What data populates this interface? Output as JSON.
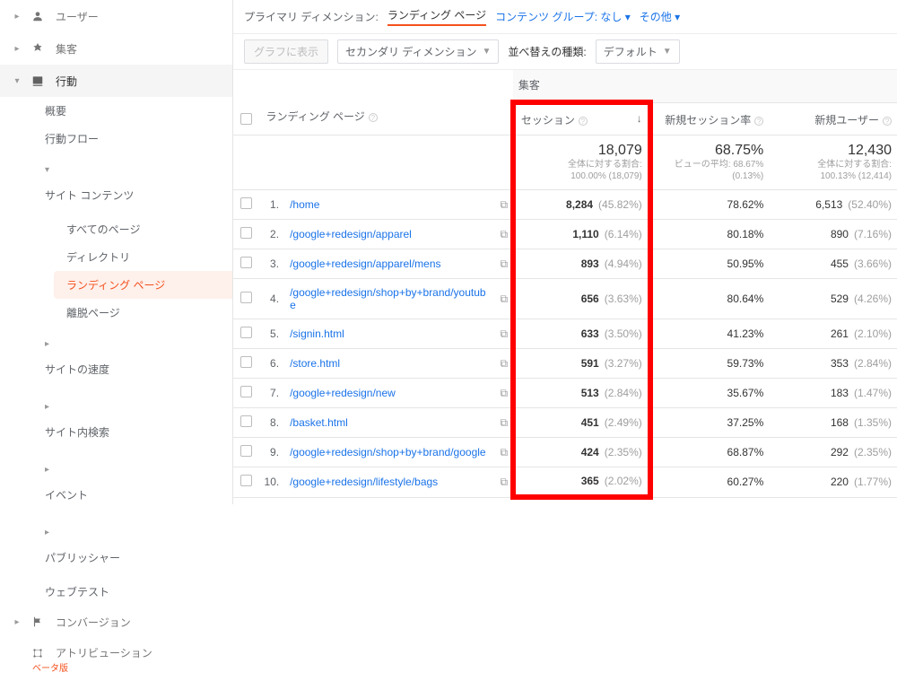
{
  "sidebar": {
    "users": "ユーザー",
    "acquisition": "集客",
    "behavior": "行動",
    "overview": "概要",
    "behavior_flow": "行動フロー",
    "site_content": "サイト コンテンツ",
    "all_pages": "すべてのページ",
    "directory": "ディレクトリ",
    "landing_pages": "ランディング ページ",
    "exit_pages": "離脱ページ",
    "site_speed": "サイトの速度",
    "site_search": "サイト内検索",
    "events": "イベント",
    "publisher": "パブリッシャー",
    "web_test": "ウェブテスト",
    "conversions": "コンバージョン",
    "attribution": "アトリビューション",
    "beta": "ベータ版"
  },
  "dimbar": {
    "primary_label": "プライマリ ディメンション:",
    "landing_page": "ランディング ページ",
    "content_group": "コンテンツ グループ: なし",
    "other": "その他"
  },
  "toolbar": {
    "graph": "グラフに表示",
    "secondary": "セカンダリ ディメンション",
    "sort_label": "並べ替えの種類:",
    "default": "デフォルト"
  },
  "header": {
    "landing_page": "ランディング ページ",
    "group": "集客",
    "sessions": "セッション",
    "new_session_rate": "新規セッション率",
    "new_users": "新規ユーザー"
  },
  "summary": {
    "sessions": {
      "big": "18,079",
      "sub1": "全体に対する割合:",
      "sub2": "100.00% (18,079)"
    },
    "rate": {
      "big": "68.75%",
      "sub1": "ビューの平均: 68.67%",
      "sub2": "(0.13%)"
    },
    "users": {
      "big": "12,430",
      "sub1": "全体に対する割合:",
      "sub2": "100.13% (12,414)"
    }
  },
  "rows": [
    {
      "url": "/home",
      "sess": "8,284",
      "sess_pct": "(45.82%)",
      "rate": "78.62%",
      "users": "6,513",
      "users_pct": "(52.40%)"
    },
    {
      "url": "/google+redesign/apparel",
      "sess": "1,110",
      "sess_pct": "(6.14%)",
      "rate": "80.18%",
      "users": "890",
      "users_pct": "(7.16%)"
    },
    {
      "url": "/google+redesign/apparel/mens",
      "sess": "893",
      "sess_pct": "(4.94%)",
      "rate": "50.95%",
      "users": "455",
      "users_pct": "(3.66%)"
    },
    {
      "url": "/google+redesign/shop+by+brand/youtube",
      "sess": "656",
      "sess_pct": "(3.63%)",
      "rate": "80.64%",
      "users": "529",
      "users_pct": "(4.26%)"
    },
    {
      "url": "/signin.html",
      "sess": "633",
      "sess_pct": "(3.50%)",
      "rate": "41.23%",
      "users": "261",
      "users_pct": "(2.10%)"
    },
    {
      "url": "/store.html",
      "sess": "591",
      "sess_pct": "(3.27%)",
      "rate": "59.73%",
      "users": "353",
      "users_pct": "(2.84%)"
    },
    {
      "url": "/google+redesign/new",
      "sess": "513",
      "sess_pct": "(2.84%)",
      "rate": "35.67%",
      "users": "183",
      "users_pct": "(1.47%)"
    },
    {
      "url": "/basket.html",
      "sess": "451",
      "sess_pct": "(2.49%)",
      "rate": "37.25%",
      "users": "168",
      "users_pct": "(1.35%)"
    },
    {
      "url": "/google+redesign/shop+by+brand/google",
      "sess": "424",
      "sess_pct": "(2.35%)",
      "rate": "68.87%",
      "users": "292",
      "users_pct": "(2.35%)"
    },
    {
      "url": "/google+redesign/lifestyle/bags",
      "sess": "365",
      "sess_pct": "(2.02%)",
      "rate": "60.27%",
      "users": "220",
      "users_pct": "(1.77%)"
    }
  ]
}
